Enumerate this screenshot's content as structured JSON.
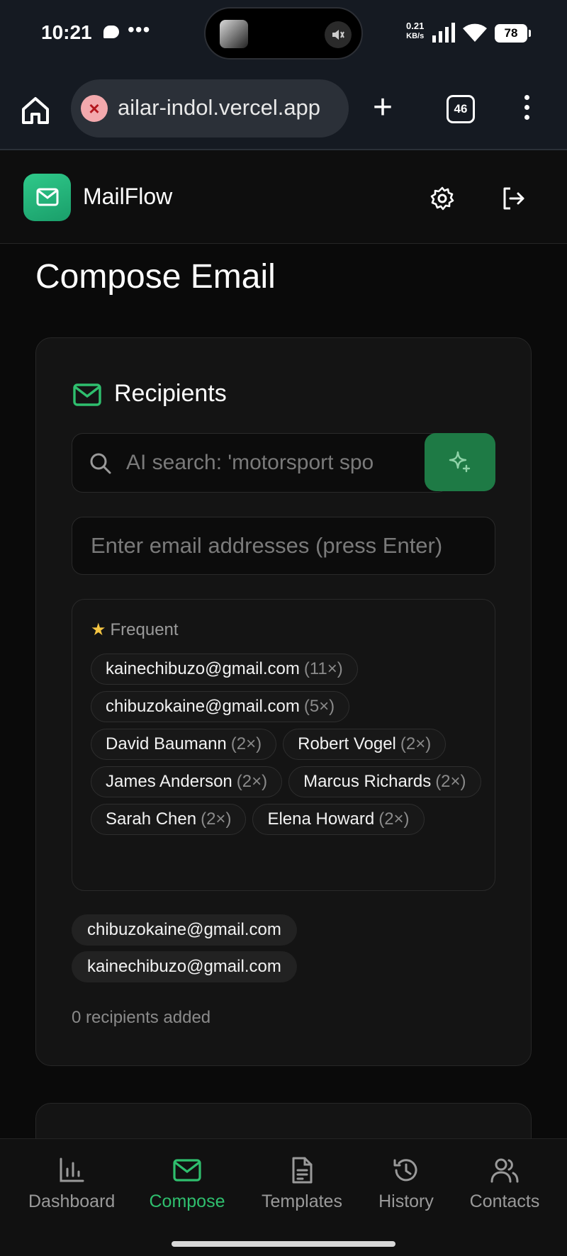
{
  "status": {
    "time": "10:21",
    "net_rate": "0.21",
    "net_unit": "KB/s",
    "battery": "78"
  },
  "browser": {
    "url": "ailar-indol.vercel.app",
    "tab_count": "46"
  },
  "app": {
    "title": "MailFlow"
  },
  "page": {
    "title": "Compose Email"
  },
  "recipients": {
    "heading": "Recipients",
    "search_placeholder": "AI search: 'motorsport spo",
    "email_placeholder": "Enter email addresses (press Enter)",
    "frequent_label": "Frequent",
    "frequent": [
      {
        "name": "kainechibuzo@gmail.com",
        "count": "(11×)"
      },
      {
        "name": "chibuzokaine@gmail.com",
        "count": "(5×)"
      },
      {
        "name": "David Baumann",
        "count": "(2×)"
      },
      {
        "name": "Robert Vogel",
        "count": "(2×)"
      },
      {
        "name": "James Anderson",
        "count": "(2×)"
      },
      {
        "name": "Marcus Richards",
        "count": "(2×)"
      },
      {
        "name": "Sarah Chen",
        "count": "(2×)"
      },
      {
        "name": "Elena Howard",
        "count": "(2×)"
      }
    ],
    "selected": [
      "chibuzokaine@gmail.com",
      "kainechibuzo@gmail.com"
    ],
    "count_text": "0 recipients added"
  },
  "nav": {
    "items": [
      "Dashboard",
      "Compose",
      "Templates",
      "History",
      "Contacts"
    ],
    "active": "Compose"
  },
  "colors": {
    "accent": "#2fbf6e",
    "ai_button": "#1e7a45",
    "logo": "#25b87c",
    "background": "#0a0a0a"
  }
}
